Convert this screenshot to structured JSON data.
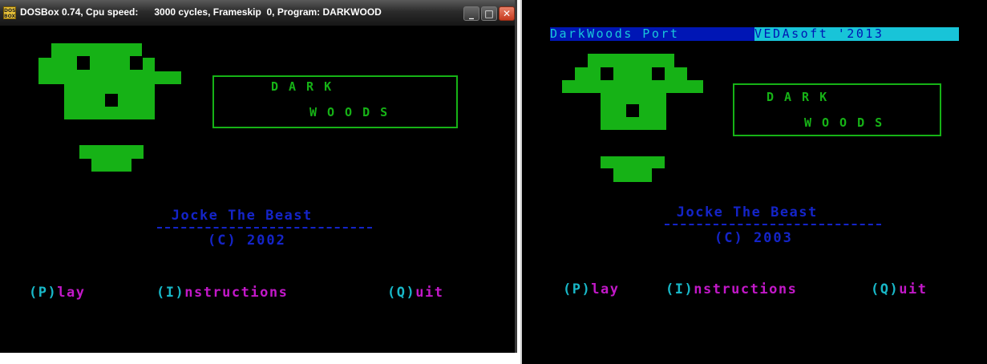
{
  "left_window": {
    "title": "DOSBox 0.74, Cpu speed:      3000 cycles, Frameskip  0, Program: DARKWOOD",
    "icon": "dosbox-app-icon",
    "controls": {
      "minimize": "minimize-icon",
      "maximize": "maximize-icon",
      "close": "close-icon"
    },
    "game": {
      "title_line1": "DARK",
      "title_line2": "WOODS",
      "author": " Jocke The Beast",
      "copyright": "(C) 2002",
      "menu": [
        {
          "key": "(P)",
          "word": "lay"
        },
        {
          "key": "(I)",
          "word": "nstructions"
        },
        {
          "key": "(Q)",
          "word": "uit"
        }
      ]
    }
  },
  "right_window": {
    "status_left": "DarkWoods Port",
    "status_right": "VEDAsoft '2013",
    "game": {
      "title_line1": "DARK",
      "title_line2": "WOODS",
      "author": " Jocke The Beast",
      "copyright": "(C) 2003",
      "menu": [
        {
          "key": "(P)",
          "word": "lay"
        },
        {
          "key": "(I)",
          "word": "nstructions"
        },
        {
          "key": "(Q)",
          "word": "uit"
        }
      ]
    }
  },
  "colors": {
    "green": "#16b216",
    "blue": "#1424c8",
    "cyan": "#18b8c8",
    "magenta": "#c218c8"
  }
}
